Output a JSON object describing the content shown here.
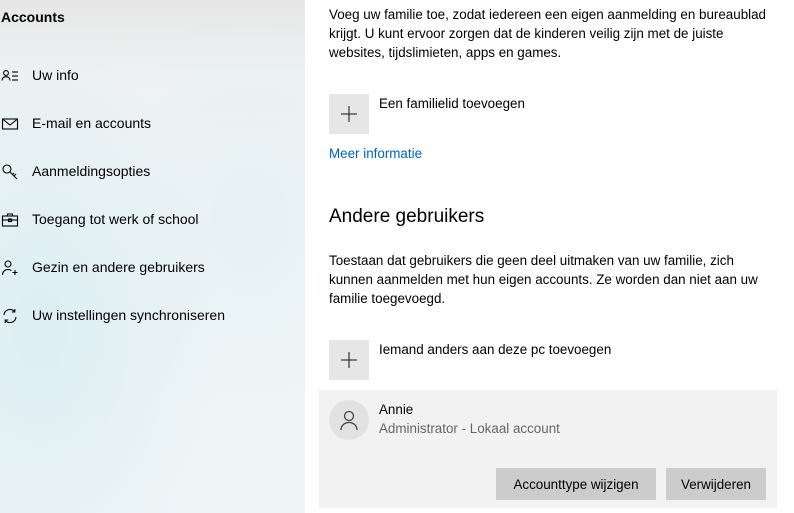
{
  "sidebar": {
    "title": "Accounts",
    "items": [
      {
        "label": "Uw info",
        "icon": "user-info-icon"
      },
      {
        "label": "E-mail en accounts",
        "icon": "mail-icon"
      },
      {
        "label": "Aanmeldingsopties",
        "icon": "key-icon"
      },
      {
        "label": "Toegang tot werk of school",
        "icon": "briefcase-icon"
      },
      {
        "label": "Gezin en andere gebruikers",
        "icon": "add-person-icon"
      },
      {
        "label": "Uw instellingen synchroniseren",
        "icon": "sync-icon"
      }
    ]
  },
  "family": {
    "description": "Voeg uw familie toe, zodat iedereen een eigen aanmelding en bureaublad krijgt. U kunt ervoor zorgen dat de kinderen veilig zijn met de juiste websites, tijdslimieten, apps en games.",
    "add_label": "Een familielid toevoegen",
    "more_info": "Meer informatie"
  },
  "other_users": {
    "title": "Andere gebruikers",
    "description": "Toestaan dat gebruikers die geen deel uitmaken van uw familie, zich kunnen aanmelden met hun eigen accounts. Ze worden dan niet aan uw familie toegevoegd.",
    "add_label": "Iemand anders aan deze pc toevoegen",
    "user": {
      "name": "Annie",
      "subtitle": "Administrator - Lokaal account",
      "change_type_button": "Accounttype wijzigen",
      "remove_button": "Verwijderen"
    }
  },
  "colors": {
    "accent_link": "#0063b1",
    "button_bg": "#cccccc",
    "plus_bg": "#e6e6e6",
    "card_bg": "#f2f2f2"
  }
}
